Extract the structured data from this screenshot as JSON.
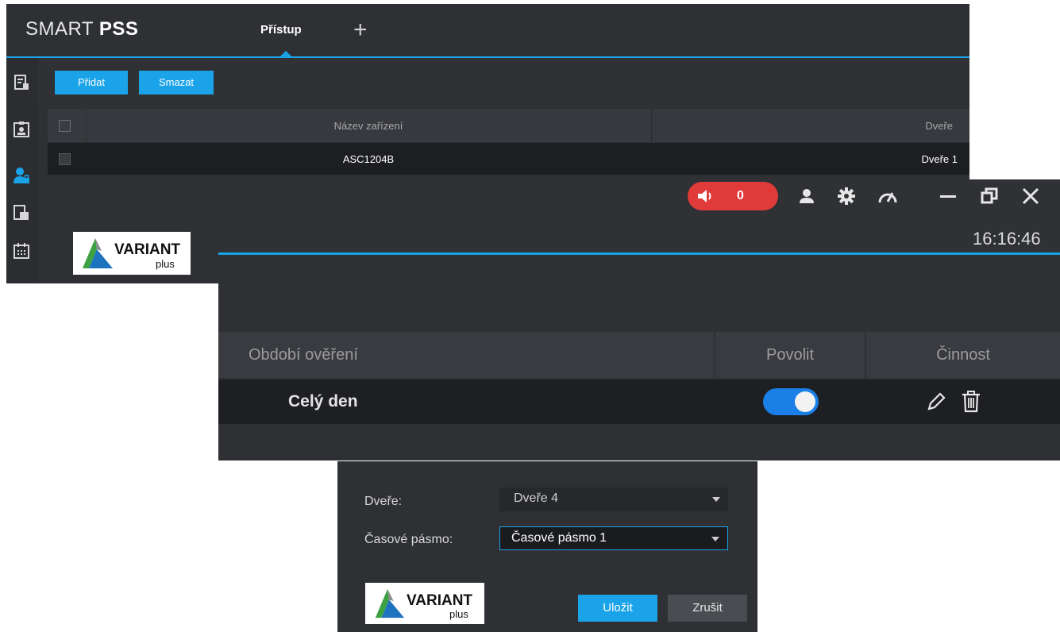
{
  "main_window": {
    "app_title_prefix": "SMART ",
    "app_title_bold": "PSS",
    "active_tab": "Přístup",
    "add_tab_symbol": "+",
    "sidebar_icons": [
      "device-icon",
      "id-card-icon",
      "user-lock-icon",
      "document-icon",
      "calendar-icon"
    ],
    "toolbar": {
      "add_label": "Přidat",
      "delete_label": "Smazat"
    },
    "table": {
      "headers": [
        "Název zařízení",
        "Dveře"
      ],
      "rows": [
        {
          "device": "ASC1204B",
          "door": "Dveře 1"
        }
      ]
    },
    "logo": {
      "word": "VARIANT",
      "sub": "plus"
    }
  },
  "period_window": {
    "alarm_count": "0",
    "toolbar_icons": [
      "speaker-icon",
      "user-icon",
      "gear-icon",
      "speedometer-icon",
      "minimize-icon",
      "restore-icon",
      "close-icon"
    ],
    "clock": "16:16:46",
    "table": {
      "headers": [
        "Období ověření",
        "Povolit",
        "Činnost"
      ],
      "rows": [
        {
          "period": "Celý den",
          "enabled": true
        }
      ]
    }
  },
  "door_dialog": {
    "door_label": "Dveře:",
    "door_value": "Dveře 4",
    "timezone_label": "Časové pásmo:",
    "timezone_value": "Časové pásmo 1",
    "save_label": "Uložit",
    "cancel_label": "Zrušit",
    "logo": {
      "word": "VARIANT",
      "sub": "plus"
    }
  },
  "colors": {
    "accent": "#1aa3e8",
    "background_dark": "#2e3034",
    "alarm_red": "#e03a3a",
    "toggle_on": "#1a7fe6"
  }
}
